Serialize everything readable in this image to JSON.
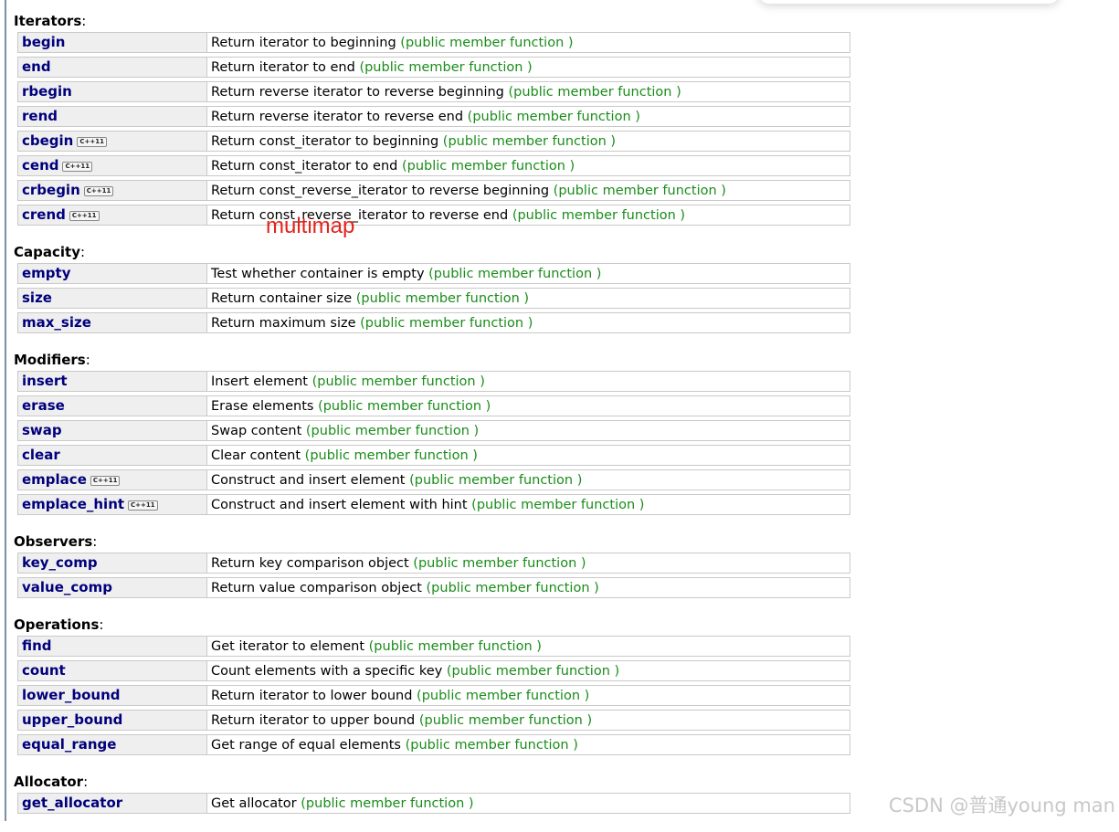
{
  "badge_label": "C++11",
  "annotation_text": "multimap",
  "watermark_text": "CSDN @普通young man",
  "sections": [
    {
      "title": "Iterators",
      "items": [
        {
          "name": "begin",
          "desc": "Return iterator to beginning",
          "type": "(public member function )",
          "cxx11": false
        },
        {
          "name": "end",
          "desc": "Return iterator to end",
          "type": "(public member function )",
          "cxx11": false
        },
        {
          "name": "rbegin",
          "desc": "Return reverse iterator to reverse beginning",
          "type": "(public member function )",
          "cxx11": false
        },
        {
          "name": "rend",
          "desc": "Return reverse iterator to reverse end",
          "type": "(public member function )",
          "cxx11": false
        },
        {
          "name": "cbegin",
          "desc": "Return const_iterator to beginning",
          "type": "(public member function )",
          "cxx11": true
        },
        {
          "name": "cend",
          "desc": "Return const_iterator to end",
          "type": "(public member function )",
          "cxx11": true
        },
        {
          "name": "crbegin",
          "desc": "Return const_reverse_iterator to reverse beginning",
          "type": "(public member function )",
          "cxx11": true
        },
        {
          "name": "crend",
          "desc": "Return const_reverse_iterator to reverse end",
          "type": "(public member function )",
          "cxx11": true
        }
      ]
    },
    {
      "title": "Capacity",
      "items": [
        {
          "name": "empty",
          "desc": "Test whether container is empty",
          "type": "(public member function )",
          "cxx11": false
        },
        {
          "name": "size",
          "desc": "Return container size",
          "type": "(public member function )",
          "cxx11": false
        },
        {
          "name": "max_size",
          "desc": "Return maximum size",
          "type": "(public member function )",
          "cxx11": false
        }
      ]
    },
    {
      "title": "Modifiers",
      "items": [
        {
          "name": "insert",
          "desc": "Insert element",
          "type": "(public member function )",
          "cxx11": false
        },
        {
          "name": "erase",
          "desc": "Erase elements",
          "type": "(public member function )",
          "cxx11": false
        },
        {
          "name": "swap",
          "desc": "Swap content",
          "type": "(public member function )",
          "cxx11": false
        },
        {
          "name": "clear",
          "desc": "Clear content",
          "type": "(public member function )",
          "cxx11": false
        },
        {
          "name": "emplace",
          "desc": "Construct and insert element",
          "type": "(public member function )",
          "cxx11": true
        },
        {
          "name": "emplace_hint",
          "desc": "Construct and insert element with hint",
          "type": "(public member function )",
          "cxx11": true
        }
      ]
    },
    {
      "title": "Observers",
      "items": [
        {
          "name": "key_comp",
          "desc": "Return key comparison object",
          "type": "(public member function )",
          "cxx11": false
        },
        {
          "name": "value_comp",
          "desc": "Return value comparison object",
          "type": "(public member function )",
          "cxx11": false
        }
      ]
    },
    {
      "title": "Operations",
      "items": [
        {
          "name": "find",
          "desc": "Get iterator to element",
          "type": "(public member function )",
          "cxx11": false
        },
        {
          "name": "count",
          "desc": "Count elements with a specific key",
          "type": "(public member function )",
          "cxx11": false
        },
        {
          "name": "lower_bound",
          "desc": "Return iterator to lower bound",
          "type": "(public member function )",
          "cxx11": false
        },
        {
          "name": "upper_bound",
          "desc": "Return iterator to upper bound",
          "type": "(public member function )",
          "cxx11": false
        },
        {
          "name": "equal_range",
          "desc": "Get range of equal elements",
          "type": "(public member function )",
          "cxx11": false
        }
      ]
    },
    {
      "title": "Allocator",
      "items": [
        {
          "name": "get_allocator",
          "desc": "Get allocator",
          "type": "(public member function )",
          "cxx11": false
        }
      ]
    }
  ]
}
